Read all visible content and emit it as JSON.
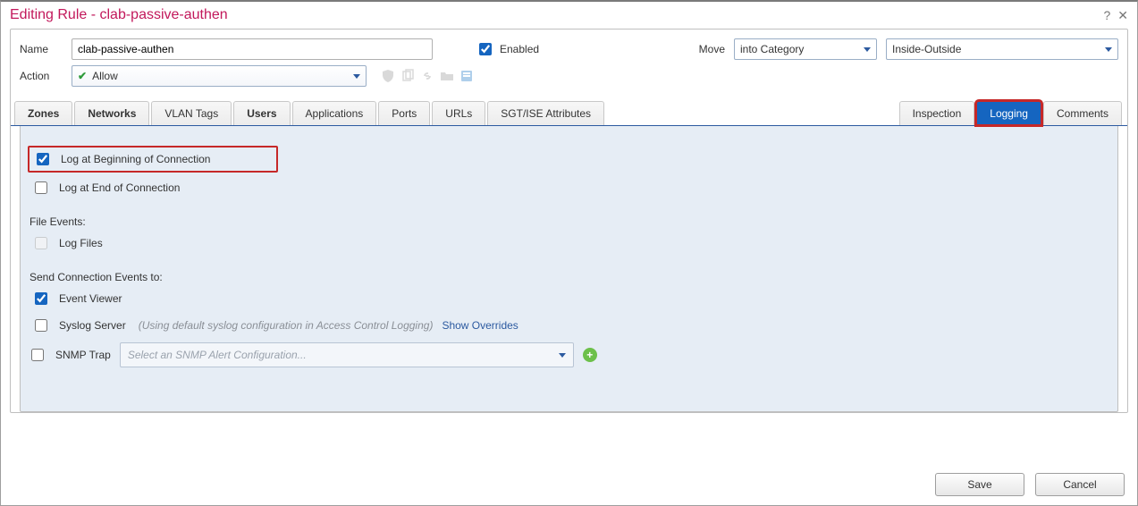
{
  "title": "Editing Rule - clab-passive-authen",
  "help_icon": "?",
  "close_icon": "✕",
  "form": {
    "name_label": "Name",
    "name_value": "clab-passive-authen",
    "enabled_label": "Enabled",
    "enabled_checked": true,
    "move_label": "Move",
    "move_category": "into Category",
    "move_position": "Inside-Outside",
    "action_label": "Action",
    "action_value": "Allow"
  },
  "tabs_left": [
    {
      "label": "Zones",
      "bold": true
    },
    {
      "label": "Networks",
      "bold": true
    },
    {
      "label": "VLAN Tags",
      "bold": false
    },
    {
      "label": "Users",
      "bold": true
    },
    {
      "label": "Applications",
      "bold": false
    },
    {
      "label": "Ports",
      "bold": false
    },
    {
      "label": "URLs",
      "bold": false
    },
    {
      "label": "SGT/ISE Attributes",
      "bold": false
    }
  ],
  "tabs_right": [
    {
      "label": "Inspection",
      "active": false
    },
    {
      "label": "Logging",
      "active": true
    },
    {
      "label": "Comments",
      "active": false
    }
  ],
  "logging": {
    "log_begin": "Log at Beginning of Connection",
    "log_begin_checked": true,
    "log_end": "Log at End of Connection",
    "log_end_checked": false,
    "file_events_header": "File Events:",
    "log_files": "Log Files",
    "send_header": "Send Connection Events to:",
    "event_viewer": "Event Viewer",
    "event_viewer_checked": true,
    "syslog": "Syslog Server",
    "syslog_note": "(Using default syslog configuration in Access Control Logging)",
    "show_overrides": "Show Overrides",
    "snmp": "SNMP Trap",
    "snmp_placeholder": "Select an SNMP Alert Configuration..."
  },
  "footer": {
    "save": "Save",
    "cancel": "Cancel"
  }
}
